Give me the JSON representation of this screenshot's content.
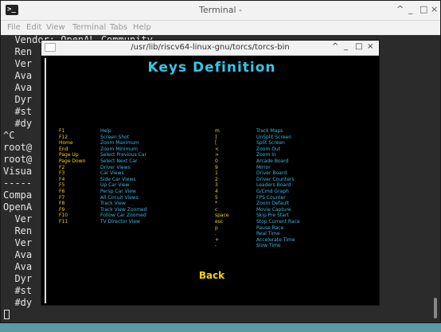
{
  "terminal": {
    "title": "Terminal -",
    "controls": [
      "^",
      "_",
      "□",
      "×"
    ],
    "menu": [
      "File",
      "Edit",
      "View",
      "Terminal",
      "Tabs",
      "Help"
    ],
    "lines": [
      "  Vendor: OpenAL Community",
      "  Ren",
      "  Ver",
      "  Ava",
      "  Ava",
      "  Dyr",
      "  #st",
      "  #dy",
      "^C",
      "root@",
      "root@",
      "Visua",
      "-----",
      "Compa",
      "OpenA",
      "  Ver",
      "  Ren",
      "  Ver",
      "  Ava",
      "  Ava",
      "  Dyr",
      "  #st",
      "  #dy",
      ""
    ]
  },
  "torcs_window": {
    "title": "/usr/lib/riscv64-linux-gnu/torcs/torcs-bin",
    "controls": [
      "^",
      "_",
      "□",
      "×"
    ],
    "heading": "Keys Definition",
    "back_label": "Back",
    "left_keys": [
      {
        "key": "F1",
        "desc": "Help"
      },
      {
        "key": "F12",
        "desc": "Screen Shot"
      },
      {
        "key": "Home",
        "desc": "Zoom Maximum"
      },
      {
        "key": "End",
        "desc": "Zoom Minimum"
      },
      {
        "key": "Page Up",
        "desc": "Select Previous Car"
      },
      {
        "key": "Page Down",
        "desc": "Select Next Car"
      },
      {
        "key": "F2",
        "desc": "Driver Views"
      },
      {
        "key": "F3",
        "desc": "Car Views"
      },
      {
        "key": "F4",
        "desc": "Side Car Views"
      },
      {
        "key": "F5",
        "desc": "Up Car View"
      },
      {
        "key": "F6",
        "desc": "Persp Car View"
      },
      {
        "key": "F7",
        "desc": "All Circuit Views"
      },
      {
        "key": "F8",
        "desc": "Track View"
      },
      {
        "key": "F9",
        "desc": "Track View Zoomed"
      },
      {
        "key": "F10",
        "desc": "Follow Car Zoomed"
      },
      {
        "key": "F11",
        "desc": "TV Director View"
      }
    ],
    "right_keys": [
      {
        "key": "m",
        "desc": "Track Maps"
      },
      {
        "key": "]",
        "desc": "UnSplit Screen"
      },
      {
        "key": "[",
        "desc": "Split Screen"
      },
      {
        "key": "<",
        "desc": "Zoom Out"
      },
      {
        "key": ">",
        "desc": "Zoom In"
      },
      {
        "key": "0",
        "desc": "Arcade Board"
      },
      {
        "key": "9",
        "desc": "Mirror"
      },
      {
        "key": "1",
        "desc": "Driver Board"
      },
      {
        "key": "2",
        "desc": "Driver Counters"
      },
      {
        "key": "3",
        "desc": "Leaders Board"
      },
      {
        "key": "4",
        "desc": "G/Cmd Graph"
      },
      {
        "key": "5",
        "desc": "FPS Counter"
      },
      {
        "key": "*",
        "desc": "Zoom Default"
      },
      {
        "key": "c",
        "desc": "Movie Capture"
      },
      {
        "key": "space",
        "desc": "Skip Pre Start"
      },
      {
        "key": "esc",
        "desc": "Stop Current Race"
      },
      {
        "key": "p",
        "desc": "Pause Race"
      },
      {
        "key": ".",
        "desc": "Real Time"
      },
      {
        "key": "+",
        "desc": "Accelerate Time"
      },
      {
        "key": "-",
        "desc": "Slow Time"
      }
    ]
  },
  "colors": {
    "heading": "#36c6e8",
    "key": "#f5d20a",
    "desc": "#38b7e0",
    "terminal_bg": "#2b2b2b",
    "desktop_bg": "#5a9aa4"
  }
}
